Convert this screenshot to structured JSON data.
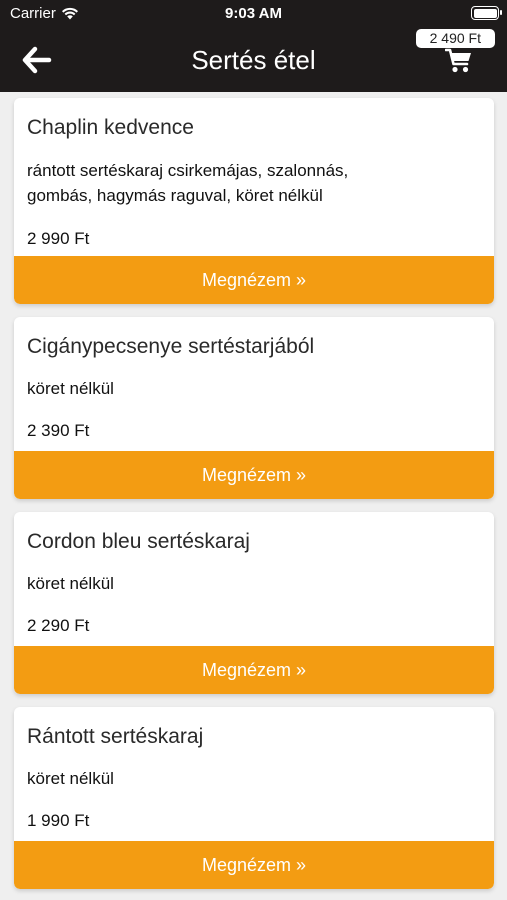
{
  "status_bar": {
    "carrier": "Carrier",
    "time": "9:03 AM"
  },
  "header": {
    "title": "Sertés étel",
    "cart_total": "2 490 Ft",
    "back_icon": "arrow-left-icon",
    "cart_icon": "shopping-cart-icon"
  },
  "colors": {
    "header_bg": "#1e1b1b",
    "accent": "#f39c12"
  },
  "items": [
    {
      "name": "Chaplin kedvence",
      "description_lines": [
        "rántott sertéskaraj csirkemájas, szalonnás,",
        "gombás, hagymás raguval, köret nélkül"
      ],
      "price": "2 990 Ft",
      "button_label": "Megnézem »"
    },
    {
      "name": "Cigánypecsenye sertéstarjából",
      "description_lines": [
        "köret nélkül"
      ],
      "price": "2 390 Ft",
      "button_label": "Megnézem »"
    },
    {
      "name": "Cordon bleu sertéskaraj",
      "description_lines": [
        "köret nélkül"
      ],
      "price": "2 290 Ft",
      "button_label": "Megnézem »"
    },
    {
      "name": "Rántott sertéskaraj",
      "description_lines": [
        "köret nélkül"
      ],
      "price": "1 990 Ft",
      "button_label": "Megnézem »"
    }
  ]
}
